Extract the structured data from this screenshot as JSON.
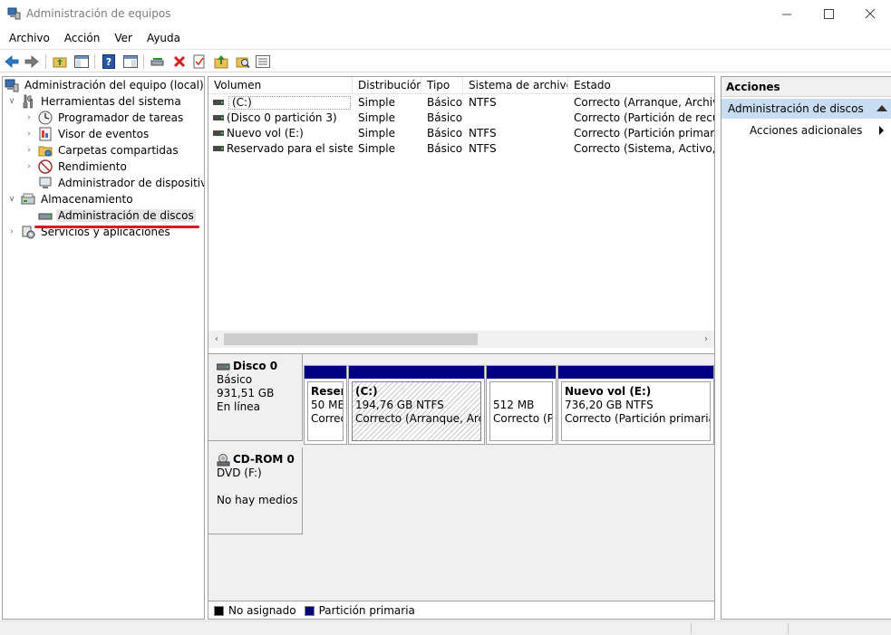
{
  "window": {
    "title": "Administración de equipos",
    "minimize_glyph": "—",
    "maximize_glyph": "☐",
    "close_glyph": "✕"
  },
  "menu": [
    "Archivo",
    "Acción",
    "Ver",
    "Ayuda"
  ],
  "tree": {
    "root": "Administración del equipo (local)",
    "system_tools": "Herramientas del sistema",
    "scheduler": "Programador de tareas",
    "event_viewer": "Visor de eventos",
    "shared_folders": "Carpetas compartidas",
    "performance": "Rendimiento",
    "device_manager": "Administrador de dispositivos",
    "storage": "Almacenamiento",
    "disk_management": "Administración de discos",
    "services": "Servicios y aplicaciones"
  },
  "volumes": {
    "columns": [
      "Volumen",
      "Distribución",
      "Tipo",
      "Sistema de archivos",
      "Estado"
    ],
    "rows": [
      {
        "volume": "(C:)",
        "layout": "Simple",
        "type": "Básico",
        "fs": "NTFS",
        "status": "Correcto (Arranque, Archivo d"
      },
      {
        "volume": "(Disco 0 partición 3)",
        "layout": "Simple",
        "type": "Básico",
        "fs": "",
        "status": "Correcto (Partición de recupe"
      },
      {
        "volume": "Nuevo vol (E:)",
        "layout": "Simple",
        "type": "Básico",
        "fs": "NTFS",
        "status": "Correcto (Partición primaria)"
      },
      {
        "volume": "Reservado para el sistema",
        "layout": "Simple",
        "type": "Básico",
        "fs": "NTFS",
        "status": "Correcto (Sistema, Activo, Par"
      }
    ]
  },
  "disks": {
    "disk0": {
      "name": "Disco 0",
      "type": "Básico",
      "size": "931,51 GB",
      "state": "En línea",
      "partitions": [
        {
          "name": "Reser",
          "size": "50 MB",
          "status": "Correc"
        },
        {
          "name": "(C:)",
          "size": "194,76 GB NTFS",
          "status": "Correcto (Arranque, Archi"
        },
        {
          "name": "",
          "size": "512 MB",
          "status": "Correcto (Pa"
        },
        {
          "name": "Nuevo vol  (E:)",
          "size": "736,20 GB NTFS",
          "status": "Correcto (Partición primaria)"
        }
      ]
    },
    "cdrom0": {
      "name": "CD-ROM 0",
      "type": "DVD (F:)",
      "media": "No hay medios"
    }
  },
  "legend": {
    "unallocated": "No asignado",
    "primary": "Partición primaria",
    "unallocated_color": "#000000",
    "primary_color": "#000080"
  },
  "actions": {
    "header": "Acciones",
    "section": "Administración de discos",
    "more": "Acciones adicionales"
  },
  "colors": {
    "selection": "#c8ddf1",
    "partition_bar": "#000080",
    "annotation_underline": "#d9191e"
  }
}
